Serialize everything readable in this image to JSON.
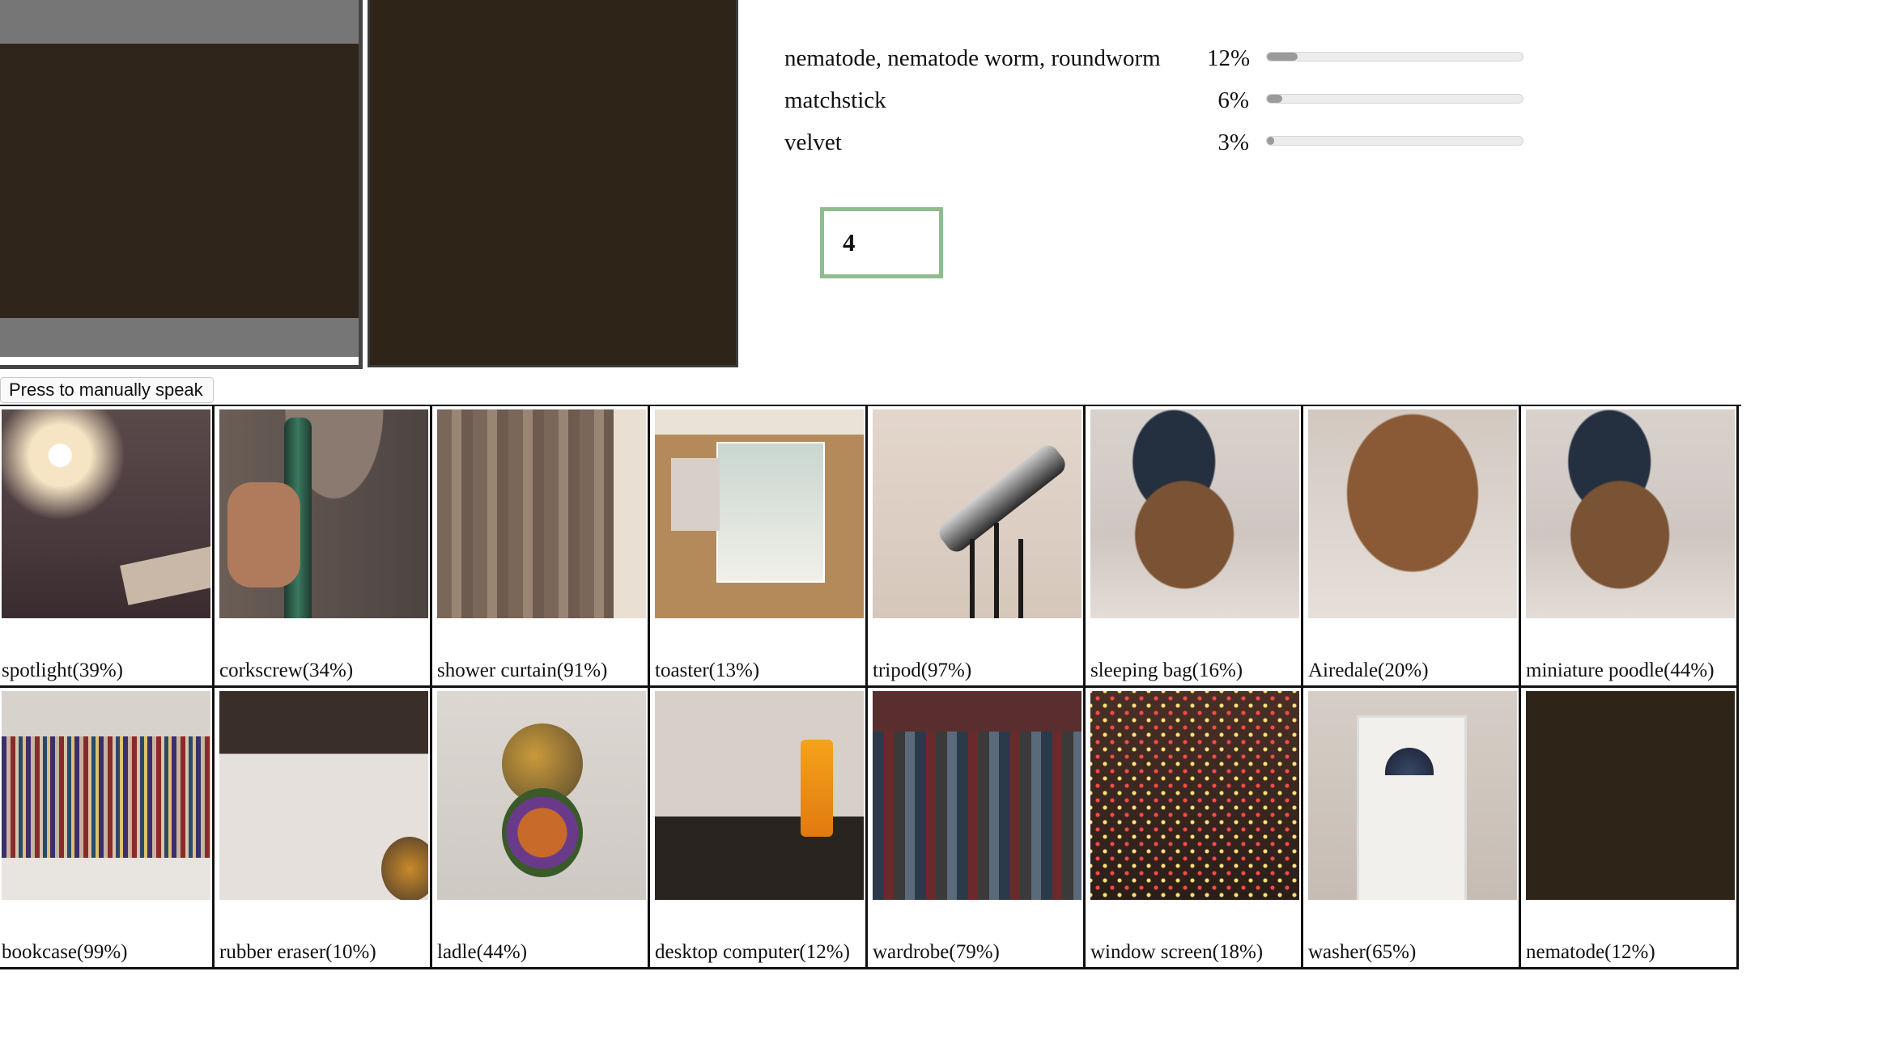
{
  "predictions": [
    {
      "label": "nematode, nematode worm, roundworm",
      "percent": "12%",
      "value": 12
    },
    {
      "label": "matchstick",
      "percent": "6%",
      "value": 6
    },
    {
      "label": "velvet",
      "percent": "3%",
      "value": 3
    }
  ],
  "counter": {
    "value": "4"
  },
  "speak_button": {
    "label": "Press to manually speak"
  },
  "gallery": [
    {
      "caption": "spotlight(39%)"
    },
    {
      "caption": "corkscrew(34%)"
    },
    {
      "caption": "shower curtain(91%)"
    },
    {
      "caption": "toaster(13%)"
    },
    {
      "caption": "tripod(97%)"
    },
    {
      "caption": "sleeping bag(16%)"
    },
    {
      "caption": "Airedale(20%)"
    },
    {
      "caption": "miniature poodle(44%)"
    },
    {
      "caption": "bookcase(99%)"
    },
    {
      "caption": "rubber eraser(10%)"
    },
    {
      "caption": "ladle(44%)"
    },
    {
      "caption": "desktop computer(12%)"
    },
    {
      "caption": "wardrobe(79%)"
    },
    {
      "caption": "window screen(18%)"
    },
    {
      "caption": "washer(65%)"
    },
    {
      "caption": "nematode(12%)"
    }
  ]
}
